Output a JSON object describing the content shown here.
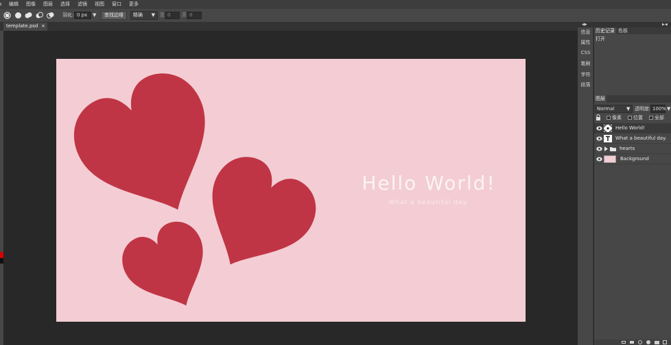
{
  "menubar": {
    "items": [
      "a",
      "编辑",
      "图像",
      "图层",
      "选择",
      "滤镜",
      "视图",
      "窗口",
      "更多"
    ]
  },
  "toolbar": {
    "feather_label": "羽化:",
    "feather_value": "0 px",
    "feather_arrow": "▼",
    "refine_button": "查找边缘",
    "style_value": "精确",
    "style_arrow": "▼",
    "width_label": "宽",
    "width_value": "0",
    "height_label": "高",
    "height_value": "0"
  },
  "tabs": [
    {
      "name": "template.psd",
      "close": "×"
    }
  ],
  "document": {
    "title_text": "Hello World!",
    "subtitle_text": "What a beautiful day."
  },
  "side_buttons": [
    "信息",
    "属性",
    "CSS",
    "笔刷",
    "字符",
    "段落"
  ],
  "panel_toggles": {
    "left": "◀▶",
    "right": "▶◀"
  },
  "history_panel": {
    "tabs": [
      "历史记录",
      "色板"
    ],
    "items": [
      "打开"
    ]
  },
  "layers_panel": {
    "tab": "图层",
    "blend_mode": "Normal",
    "blend_arrow": "▼",
    "opacity_label": "透明度:",
    "opacity_value": "100%",
    "opacity_arrow": "▼",
    "lock_options": [
      "像素",
      "位置",
      "全部"
    ],
    "layers": [
      {
        "name": "Hello World!",
        "type": "text",
        "selected": true
      },
      {
        "name": "What a beautiful day.",
        "type": "text",
        "selected": false
      },
      {
        "name": "hearts",
        "type": "folder",
        "selected": false
      },
      {
        "name": "Background",
        "type": "image",
        "selected": false
      }
    ]
  },
  "colors": {
    "document_bg": "#f3cdd3",
    "heart": "#c03545",
    "foreground_swatch": "#d40000",
    "background_swatch": "#111111",
    "canvas_bg": "#282828",
    "panel_bg": "#474747"
  },
  "icons": [
    "eye-icon",
    "lock-icon",
    "folder-icon",
    "text-layer-icon",
    "selection-mode-icon"
  ]
}
